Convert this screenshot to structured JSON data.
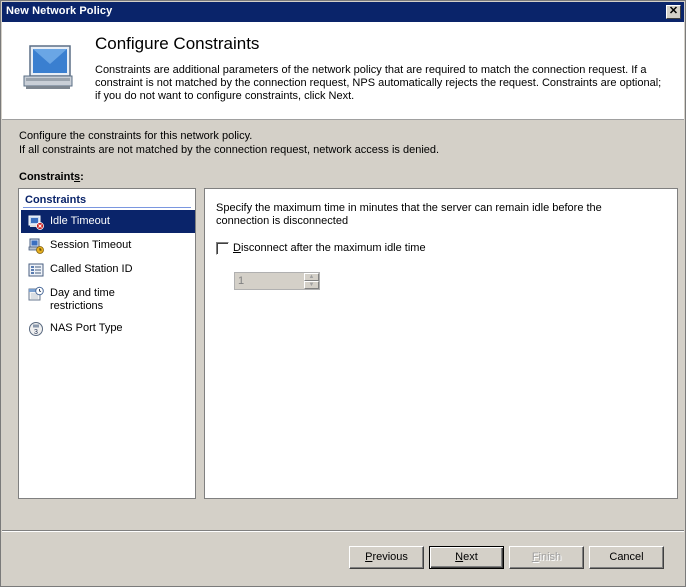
{
  "window": {
    "title": "New Network Policy"
  },
  "header": {
    "title": "Configure Constraints",
    "description": "Constraints are additional parameters of the network policy that are required to match the connection request. If a constraint is not matched by the connection request, NPS automatically rejects the request. Constraints are optional; if you do not want to configure constraints, click Next."
  },
  "intro": {
    "line1": "Configure the constraints for this network policy.",
    "line2": "If all constraints are not matched by the connection request, network access is denied."
  },
  "constraints_label_pre": "Constraint",
  "constraints_label_mnemonic": "s",
  "constraints_label_post": ":",
  "list": {
    "header": "Constraints",
    "items": [
      {
        "label": "Idle Timeout",
        "icon": "idle-timeout-icon",
        "selected": true
      },
      {
        "label": "Session Timeout",
        "icon": "session-timeout-icon",
        "selected": false
      },
      {
        "label": "Called Station ID",
        "icon": "called-station-icon",
        "selected": false
      },
      {
        "label": "Day and time restrictions",
        "icon": "day-time-icon",
        "selected": false
      },
      {
        "label": "NAS Port Type",
        "icon": "nas-port-icon",
        "selected": false
      }
    ]
  },
  "detail": {
    "description": "Specify the maximum time in minutes that the server can remain idle before the connection is disconnected",
    "checkbox_mnemonic": "D",
    "checkbox_label_rest": "isconnect after the maximum idle time",
    "checkbox_checked": false,
    "spinner_value": "1"
  },
  "buttons": {
    "previous_mnemonic": "P",
    "previous_rest": "revious",
    "next_mnemonic": "N",
    "next_rest": "ext",
    "finish_mnemonic": "F",
    "finish_rest": "inish",
    "cancel": "Cancel"
  }
}
